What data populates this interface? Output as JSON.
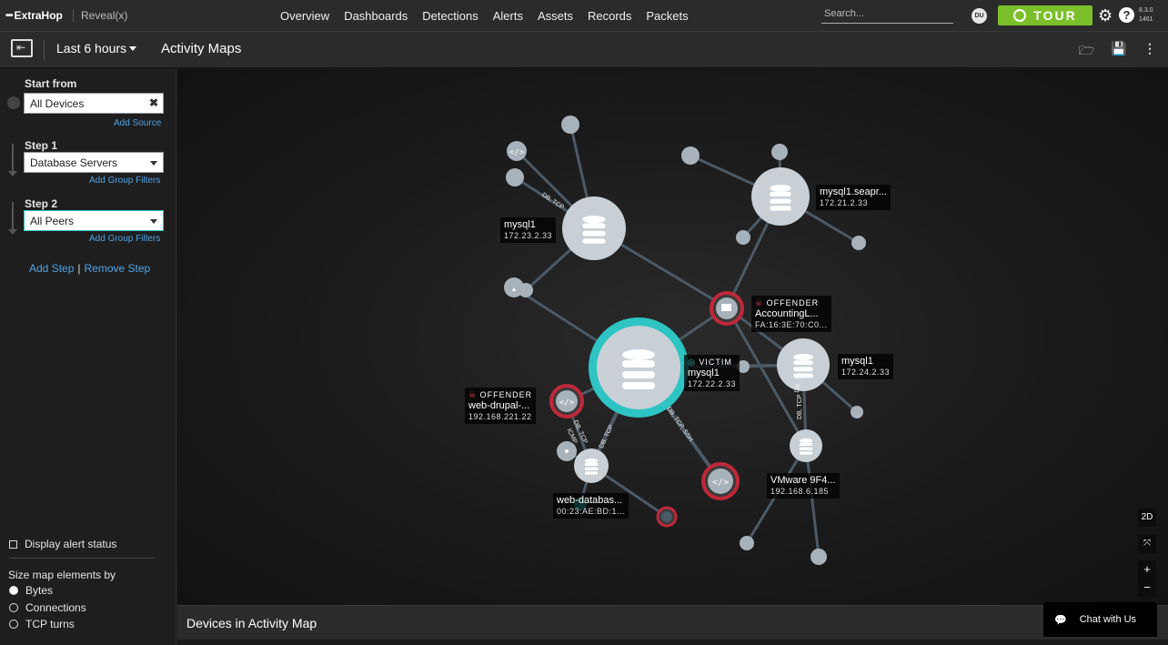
{
  "app": {
    "logo_text": "ExtraHop",
    "logo_mark": "•••",
    "product": "Reveal(x)"
  },
  "nav": {
    "items": [
      "Overview",
      "Dashboards",
      "Detections",
      "Alerts",
      "Assets",
      "Records",
      "Packets"
    ]
  },
  "search": {
    "placeholder": "Search..."
  },
  "user": {
    "initials": "DU"
  },
  "tour": {
    "label": "TOUR",
    "color": "#7bbf2a"
  },
  "version": {
    "line1": "8.3.0",
    "line2": "1461"
  },
  "subheader": {
    "time_range": "Last 6 hours",
    "title": "Activity Maps"
  },
  "sidebar": {
    "start_from_label": "Start from",
    "start_from_value": "All Devices",
    "add_source": "Add Source",
    "step1_label": "Step 1",
    "step1_value": "Database Servers",
    "step1_filters": "Add Group Filters",
    "step2_label": "Step 2",
    "step2_value": "All Peers",
    "step2_filters": "Add Group Filters",
    "add_step": "Add Step",
    "separator": "|",
    "remove_step": "Remove Step",
    "display_alert_status": "Display alert status",
    "size_by_label": "Size map elements by",
    "size_options": [
      "Bytes",
      "Connections",
      "TCP turns"
    ],
    "size_selected": "Bytes"
  },
  "map": {
    "colors": {
      "offender": "#c0283a",
      "victim": "#2ec4c4",
      "node": "#c8d0d6",
      "edge": "#4b5a66"
    },
    "nodes": {
      "mysql1_top": {
        "name": "mysql1",
        "ip": "172.23.2.33"
      },
      "mysql1_seapr": {
        "name": "mysql1.seapr...",
        "ip": "172.21.2.33"
      },
      "accounting": {
        "tag": "OFFENDER",
        "name": "AccountingL...",
        "ip": "FA:16:3E:70:C0..."
      },
      "victim": {
        "tag": "VICTIM",
        "name": "mysql1",
        "ip": "172.22.2.33"
      },
      "mysql1_right": {
        "name": "mysql1",
        "ip": "172.24.2.33"
      },
      "drupal": {
        "tag": "OFFENDER",
        "name": "web-drupal-...",
        "ip": "192.168.221.22"
      },
      "webdb": {
        "name": "web-databas...",
        "ip": "00:23:AE:BD:1..."
      },
      "vmware": {
        "name": "VMware 9F4...",
        "ip": "192.168.6.185"
      }
    },
    "edge_labels": {
      "e1": "DB, TCP",
      "e2": "DB, TCP",
      "e3": "DB, TCP",
      "e4": "DB, TCP",
      "e5": "ICMP",
      "e6": "DB, TCP",
      "e7": "DB, TCP, SSH"
    },
    "controls": {
      "view": "2D",
      "zoom_in": "+",
      "zoom_out": "−"
    }
  },
  "bottom": {
    "title": "Devices in Activity Map"
  },
  "chat": {
    "label": "Chat with Us"
  }
}
